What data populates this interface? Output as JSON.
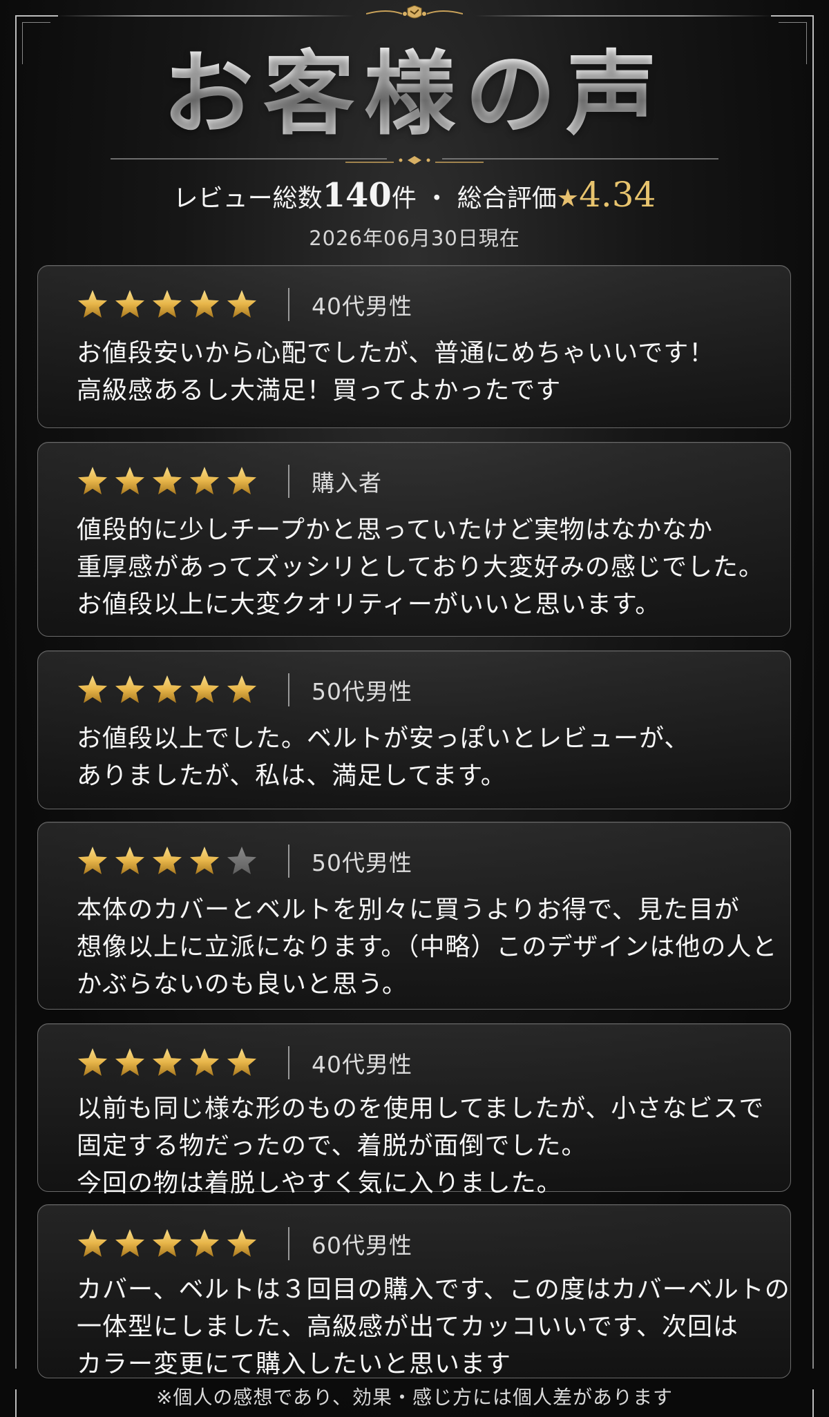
{
  "header": {
    "title": "お客様の声",
    "summary_prefix": "レビュー総数",
    "review_count": "140",
    "count_unit": "件",
    "summary_separator": "・",
    "rating_label": "総合評価",
    "rating_star": "★",
    "rating_value": "4.34",
    "date": "2026年06月30日現在"
  },
  "colors": {
    "star_gold": "#e8b64a",
    "star_empty": "#5e5e5e",
    "background": "#0c0c0c"
  },
  "reviews": [
    {
      "rating": 5,
      "reviewer": "40代男性",
      "lines": [
        "お値段安いから心配でしたが、普通にめちゃいいです！",
        "高級感あるし大満足！買ってよかったです"
      ]
    },
    {
      "rating": 5,
      "reviewer": "購入者",
      "lines": [
        "値段的に少しチープかと思っていたけど実物はなかなか",
        "重厚感があってズッシリとしており大変好みの感じでした。",
        "お値段以上に大変クオリティーがいいと思います。"
      ]
    },
    {
      "rating": 5,
      "reviewer": "50代男性",
      "lines": [
        "お値段以上でした。ベルトが安っぽいとレビューが、",
        "ありましたが、私は、満足してます。"
      ]
    },
    {
      "rating": 4,
      "reviewer": "50代男性",
      "lines": [
        "本体のカバーとベルトを別々に買うよりお得で、見た目が",
        "想像以上に立派になります。（中略）このデザインは他の人と",
        "かぶらないのも良いと思う。"
      ]
    },
    {
      "rating": 5,
      "reviewer": "40代男性",
      "lines": [
        "以前も同じ様な形のものを使用してましたが、小さなビスで",
        "固定する物だったので、着脱が面倒でした。",
        "今回の物は着脱しやすく気に入りました。"
      ]
    },
    {
      "rating": 5,
      "reviewer": "60代男性",
      "lines": [
        "カバー、ベルトは３回目の購入です、この度はカバーベルトの",
        "一体型にしました、高級感が出てカッコいいです、次回は",
        "カラー変更にて購入したいと思います"
      ]
    }
  ],
  "footnote": "※個人の感想であり、効果・感じ方には個人差があります"
}
